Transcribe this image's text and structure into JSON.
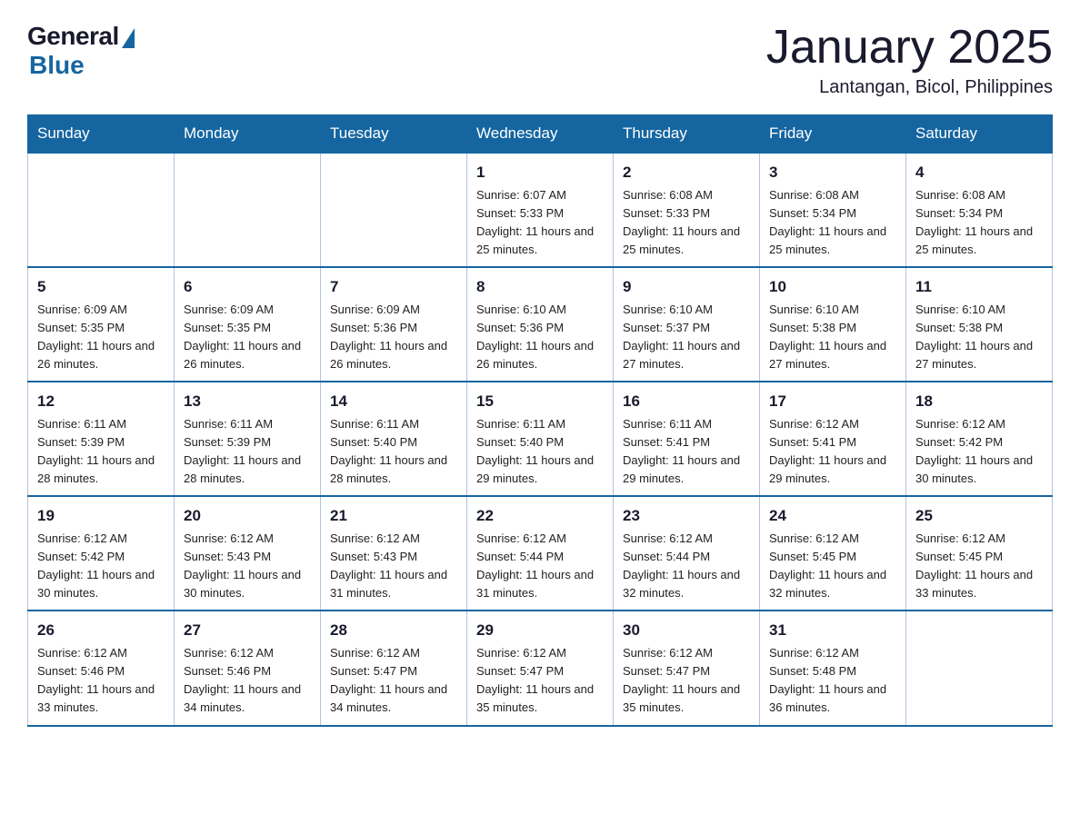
{
  "logo": {
    "general": "General",
    "blue": "Blue"
  },
  "header": {
    "month": "January 2025",
    "location": "Lantangan, Bicol, Philippines"
  },
  "days_of_week": [
    "Sunday",
    "Monday",
    "Tuesday",
    "Wednesday",
    "Thursday",
    "Friday",
    "Saturday"
  ],
  "weeks": [
    [
      {
        "day": "",
        "info": ""
      },
      {
        "day": "",
        "info": ""
      },
      {
        "day": "",
        "info": ""
      },
      {
        "day": "1",
        "info": "Sunrise: 6:07 AM\nSunset: 5:33 PM\nDaylight: 11 hours\nand 25 minutes."
      },
      {
        "day": "2",
        "info": "Sunrise: 6:08 AM\nSunset: 5:33 PM\nDaylight: 11 hours\nand 25 minutes."
      },
      {
        "day": "3",
        "info": "Sunrise: 6:08 AM\nSunset: 5:34 PM\nDaylight: 11 hours\nand 25 minutes."
      },
      {
        "day": "4",
        "info": "Sunrise: 6:08 AM\nSunset: 5:34 PM\nDaylight: 11 hours\nand 25 minutes."
      }
    ],
    [
      {
        "day": "5",
        "info": "Sunrise: 6:09 AM\nSunset: 5:35 PM\nDaylight: 11 hours\nand 26 minutes."
      },
      {
        "day": "6",
        "info": "Sunrise: 6:09 AM\nSunset: 5:35 PM\nDaylight: 11 hours\nand 26 minutes."
      },
      {
        "day": "7",
        "info": "Sunrise: 6:09 AM\nSunset: 5:36 PM\nDaylight: 11 hours\nand 26 minutes."
      },
      {
        "day": "8",
        "info": "Sunrise: 6:10 AM\nSunset: 5:36 PM\nDaylight: 11 hours\nand 26 minutes."
      },
      {
        "day": "9",
        "info": "Sunrise: 6:10 AM\nSunset: 5:37 PM\nDaylight: 11 hours\nand 27 minutes."
      },
      {
        "day": "10",
        "info": "Sunrise: 6:10 AM\nSunset: 5:38 PM\nDaylight: 11 hours\nand 27 minutes."
      },
      {
        "day": "11",
        "info": "Sunrise: 6:10 AM\nSunset: 5:38 PM\nDaylight: 11 hours\nand 27 minutes."
      }
    ],
    [
      {
        "day": "12",
        "info": "Sunrise: 6:11 AM\nSunset: 5:39 PM\nDaylight: 11 hours\nand 28 minutes."
      },
      {
        "day": "13",
        "info": "Sunrise: 6:11 AM\nSunset: 5:39 PM\nDaylight: 11 hours\nand 28 minutes."
      },
      {
        "day": "14",
        "info": "Sunrise: 6:11 AM\nSunset: 5:40 PM\nDaylight: 11 hours\nand 28 minutes."
      },
      {
        "day": "15",
        "info": "Sunrise: 6:11 AM\nSunset: 5:40 PM\nDaylight: 11 hours\nand 29 minutes."
      },
      {
        "day": "16",
        "info": "Sunrise: 6:11 AM\nSunset: 5:41 PM\nDaylight: 11 hours\nand 29 minutes."
      },
      {
        "day": "17",
        "info": "Sunrise: 6:12 AM\nSunset: 5:41 PM\nDaylight: 11 hours\nand 29 minutes."
      },
      {
        "day": "18",
        "info": "Sunrise: 6:12 AM\nSunset: 5:42 PM\nDaylight: 11 hours\nand 30 minutes."
      }
    ],
    [
      {
        "day": "19",
        "info": "Sunrise: 6:12 AM\nSunset: 5:42 PM\nDaylight: 11 hours\nand 30 minutes."
      },
      {
        "day": "20",
        "info": "Sunrise: 6:12 AM\nSunset: 5:43 PM\nDaylight: 11 hours\nand 30 minutes."
      },
      {
        "day": "21",
        "info": "Sunrise: 6:12 AM\nSunset: 5:43 PM\nDaylight: 11 hours\nand 31 minutes."
      },
      {
        "day": "22",
        "info": "Sunrise: 6:12 AM\nSunset: 5:44 PM\nDaylight: 11 hours\nand 31 minutes."
      },
      {
        "day": "23",
        "info": "Sunrise: 6:12 AM\nSunset: 5:44 PM\nDaylight: 11 hours\nand 32 minutes."
      },
      {
        "day": "24",
        "info": "Sunrise: 6:12 AM\nSunset: 5:45 PM\nDaylight: 11 hours\nand 32 minutes."
      },
      {
        "day": "25",
        "info": "Sunrise: 6:12 AM\nSunset: 5:45 PM\nDaylight: 11 hours\nand 33 minutes."
      }
    ],
    [
      {
        "day": "26",
        "info": "Sunrise: 6:12 AM\nSunset: 5:46 PM\nDaylight: 11 hours\nand 33 minutes."
      },
      {
        "day": "27",
        "info": "Sunrise: 6:12 AM\nSunset: 5:46 PM\nDaylight: 11 hours\nand 34 minutes."
      },
      {
        "day": "28",
        "info": "Sunrise: 6:12 AM\nSunset: 5:47 PM\nDaylight: 11 hours\nand 34 minutes."
      },
      {
        "day": "29",
        "info": "Sunrise: 6:12 AM\nSunset: 5:47 PM\nDaylight: 11 hours\nand 35 minutes."
      },
      {
        "day": "30",
        "info": "Sunrise: 6:12 AM\nSunset: 5:47 PM\nDaylight: 11 hours\nand 35 minutes."
      },
      {
        "day": "31",
        "info": "Sunrise: 6:12 AM\nSunset: 5:48 PM\nDaylight: 11 hours\nand 36 minutes."
      },
      {
        "day": "",
        "info": ""
      }
    ]
  ]
}
